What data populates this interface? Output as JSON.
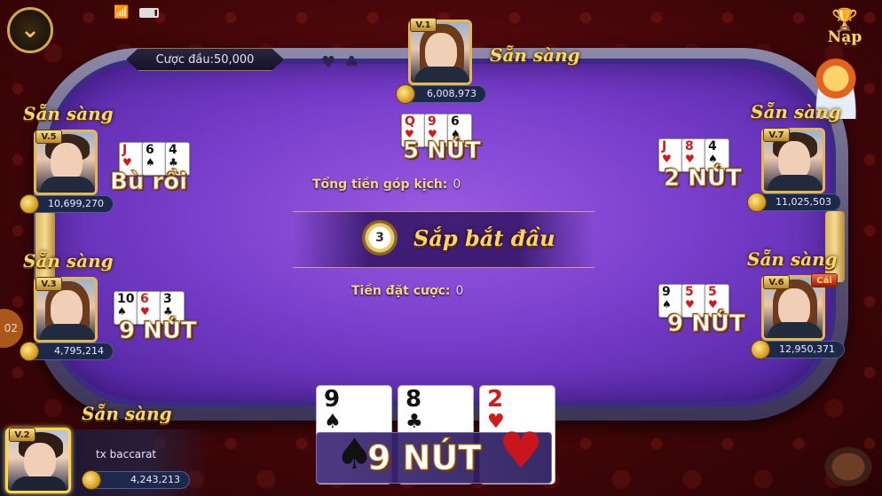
{
  "header": {
    "bet_label": "Cược đầu:50,000",
    "nap_label": "Nạp"
  },
  "ready_label": "Sẵn sàng",
  "table": {
    "pot_label": "Tổng tiền góp kịch:",
    "pot_value": "0",
    "bet_label": "Tiền đặt cược:",
    "bet_value": "0",
    "countdown": "3",
    "status": "Sắp bắt đầu"
  },
  "players": {
    "top": {
      "vip": "V.1",
      "money": "6,008,973",
      "cards": [
        {
          "rank": "Q",
          "suit": "♥",
          "red": true
        },
        {
          "rank": "9",
          "suit": "♥",
          "red": true
        },
        {
          "rank": "6",
          "suit": "♠",
          "red": false
        }
      ],
      "result": "5 NÚT"
    },
    "left_upper": {
      "vip": "V.5",
      "money": "10,699,270",
      "cards": [
        {
          "rank": "J",
          "suit": "♥",
          "red": true
        },
        {
          "rank": "6",
          "suit": "♠",
          "red": false
        },
        {
          "rank": "4",
          "suit": "♣",
          "red": false
        }
      ],
      "result": "Bù rồi"
    },
    "left_lower": {
      "vip": "V.3",
      "money": "4,795,214",
      "cards": [
        {
          "rank": "10",
          "suit": "♠",
          "red": false
        },
        {
          "rank": "6",
          "suit": "♥",
          "red": true
        },
        {
          "rank": "3",
          "suit": "♣",
          "red": false
        }
      ],
      "result": "9 NÚT"
    },
    "right_upper": {
      "vip": "V.7",
      "money": "11,025,503",
      "cards": [
        {
          "rank": "J",
          "suit": "♥",
          "red": true
        },
        {
          "rank": "8",
          "suit": "♥",
          "red": true
        },
        {
          "rank": "4",
          "suit": "♠",
          "red": false
        }
      ],
      "result": "2 NÚT"
    },
    "right_lower": {
      "vip": "V.6",
      "dealer_badge": "Cái",
      "money": "12,950,371",
      "cards": [
        {
          "rank": "9",
          "suit": "♠",
          "red": false
        },
        {
          "rank": "5",
          "suit": "♥",
          "red": true
        },
        {
          "rank": "5",
          "suit": "♥",
          "red": true
        }
      ],
      "result": "9 NÚT"
    },
    "me": {
      "vip": "V.2",
      "name": "tx baccarat",
      "money": "4,243,213",
      "cards": [
        {
          "rank": "9",
          "suit": "♠",
          "red": false
        },
        {
          "rank": "8",
          "suit": "♣",
          "red": false
        },
        {
          "rank": "2",
          "suit": "♥",
          "red": true
        }
      ],
      "result": "9 NÚT"
    }
  },
  "side_timer": "02",
  "colors": {
    "felt": "#7a3fcd",
    "gold": "#ffd95e",
    "background": "#4a070a"
  }
}
